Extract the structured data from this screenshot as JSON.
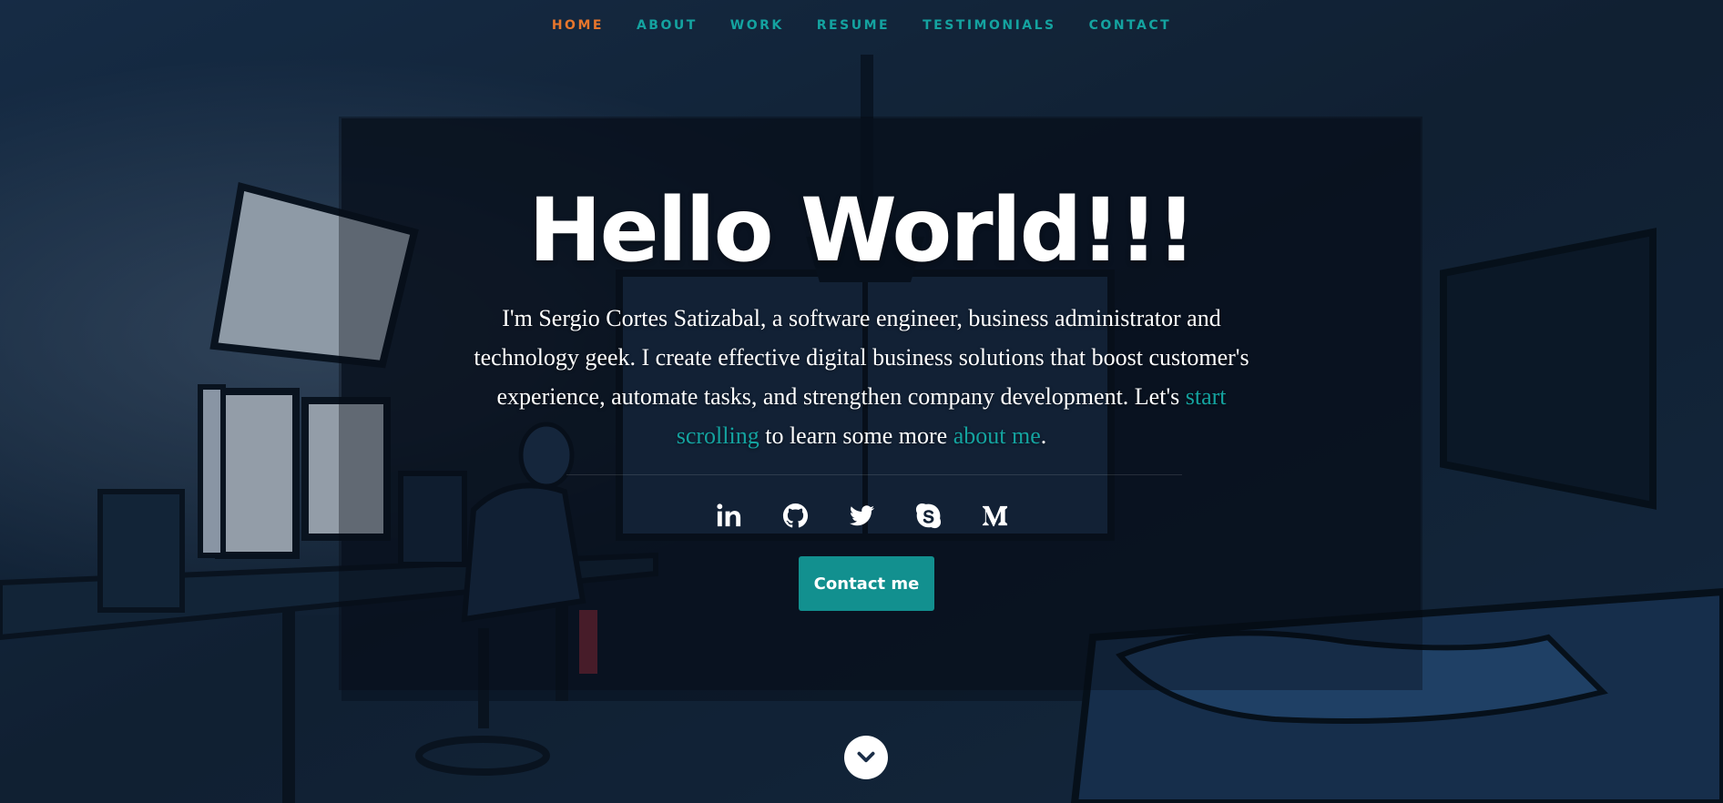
{
  "nav": {
    "items": [
      {
        "label": "HOME",
        "active": true
      },
      {
        "label": "ABOUT"
      },
      {
        "label": "WORK"
      },
      {
        "label": "RESUME"
      },
      {
        "label": "TESTIMONIALS"
      },
      {
        "label": "CONTACT"
      }
    ]
  },
  "hero": {
    "title": "Hello World!!!",
    "intro_before": "I'm Sergio Cortes Satizabal, a software engineer, business administrator and technology geek. I create effective digital business solutions that boost customer's experience, automate tasks, and strengthen company development. Let's ",
    "link_scrolling": "start scrolling",
    "intro_middle": " to learn some more ",
    "link_about": "about me",
    "intro_end": ".",
    "contact_label": "Contact me"
  },
  "social": [
    "linkedin-icon",
    "github-icon",
    "twitter-icon",
    "skype-icon",
    "medium-icon"
  ],
  "colors": {
    "accent": "#14a3a0",
    "active_nav": "#e8762c",
    "button": "#12908f",
    "text": "#ffffff"
  }
}
